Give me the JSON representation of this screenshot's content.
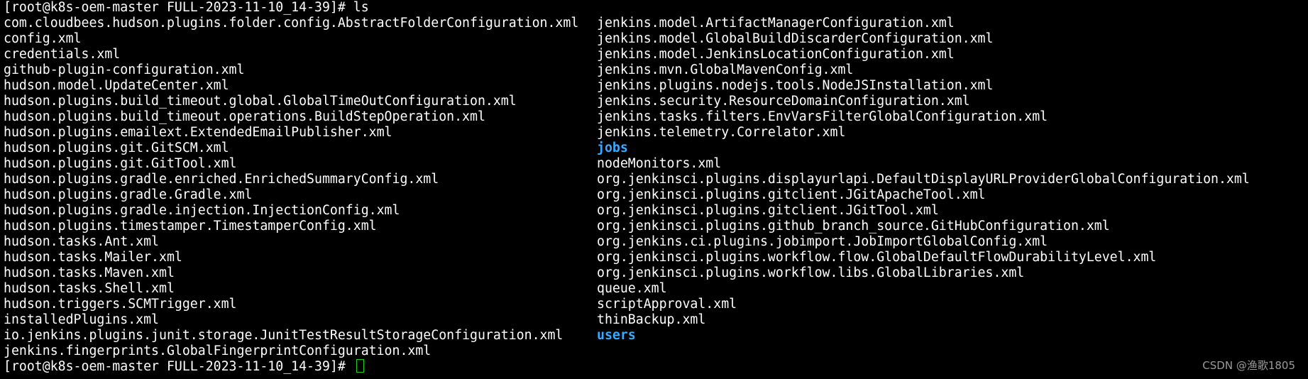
{
  "terminal": {
    "command_line": "[root@k8s-oem-master FULL-2023-11-10_14-39]# ls",
    "prompt": "[root@k8s-oem-master FULL-2023-11-10_14-39]# ",
    "colors": {
      "background": "#000000",
      "text": "#ffffff",
      "directory": "#3aa9ff",
      "cursor": "#19d219"
    },
    "left_column": [
      {
        "name": "com.cloudbees.hudson.plugins.folder.config.AbstractFolderConfiguration.xml",
        "type": "file"
      },
      {
        "name": "config.xml",
        "type": "file"
      },
      {
        "name": "credentials.xml",
        "type": "file"
      },
      {
        "name": "github-plugin-configuration.xml",
        "type": "file"
      },
      {
        "name": "hudson.model.UpdateCenter.xml",
        "type": "file"
      },
      {
        "name": "hudson.plugins.build_timeout.global.GlobalTimeOutConfiguration.xml",
        "type": "file"
      },
      {
        "name": "hudson.plugins.build_timeout.operations.BuildStepOperation.xml",
        "type": "file"
      },
      {
        "name": "hudson.plugins.emailext.ExtendedEmailPublisher.xml",
        "type": "file"
      },
      {
        "name": "hudson.plugins.git.GitSCM.xml",
        "type": "file"
      },
      {
        "name": "hudson.plugins.git.GitTool.xml",
        "type": "file"
      },
      {
        "name": "hudson.plugins.gradle.enriched.EnrichedSummaryConfig.xml",
        "type": "file"
      },
      {
        "name": "hudson.plugins.gradle.Gradle.xml",
        "type": "file"
      },
      {
        "name": "hudson.plugins.gradle.injection.InjectionConfig.xml",
        "type": "file"
      },
      {
        "name": "hudson.plugins.timestamper.TimestamperConfig.xml",
        "type": "file"
      },
      {
        "name": "hudson.tasks.Ant.xml",
        "type": "file"
      },
      {
        "name": "hudson.tasks.Mailer.xml",
        "type": "file"
      },
      {
        "name": "hudson.tasks.Maven.xml",
        "type": "file"
      },
      {
        "name": "hudson.tasks.Shell.xml",
        "type": "file"
      },
      {
        "name": "hudson.triggers.SCMTrigger.xml",
        "type": "file"
      },
      {
        "name": "installedPlugins.xml",
        "type": "file"
      },
      {
        "name": "io.jenkins.plugins.junit.storage.JunitTestResultStorageConfiguration.xml",
        "type": "file"
      },
      {
        "name": "jenkins.fingerprints.GlobalFingerprintConfiguration.xml",
        "type": "file"
      }
    ],
    "right_column": [
      {
        "name": "jenkins.model.ArtifactManagerConfiguration.xml",
        "type": "file"
      },
      {
        "name": "jenkins.model.GlobalBuildDiscarderConfiguration.xml",
        "type": "file"
      },
      {
        "name": "jenkins.model.JenkinsLocationConfiguration.xml",
        "type": "file"
      },
      {
        "name": "jenkins.mvn.GlobalMavenConfig.xml",
        "type": "file"
      },
      {
        "name": "jenkins.plugins.nodejs.tools.NodeJSInstallation.xml",
        "type": "file"
      },
      {
        "name": "jenkins.security.ResourceDomainConfiguration.xml",
        "type": "file"
      },
      {
        "name": "jenkins.tasks.filters.EnvVarsFilterGlobalConfiguration.xml",
        "type": "file"
      },
      {
        "name": "jenkins.telemetry.Correlator.xml",
        "type": "file"
      },
      {
        "name": "jobs",
        "type": "dir"
      },
      {
        "name": "nodeMonitors.xml",
        "type": "file"
      },
      {
        "name": "org.jenkinsci.plugins.displayurlapi.DefaultDisplayURLProviderGlobalConfiguration.xml",
        "type": "file"
      },
      {
        "name": "org.jenkinsci.plugins.gitclient.JGitApacheTool.xml",
        "type": "file"
      },
      {
        "name": "org.jenkinsci.plugins.gitclient.JGitTool.xml",
        "type": "file"
      },
      {
        "name": "org.jenkinsci.plugins.github_branch_source.GitHubConfiguration.xml",
        "type": "file"
      },
      {
        "name": "org.jenkins.ci.plugins.jobimport.JobImportGlobalConfig.xml",
        "type": "file"
      },
      {
        "name": "org.jenkinsci.plugins.workflow.flow.GlobalDefaultFlowDurabilityLevel.xml",
        "type": "file"
      },
      {
        "name": "org.jenkinsci.plugins.workflow.libs.GlobalLibraries.xml",
        "type": "file"
      },
      {
        "name": "queue.xml",
        "type": "file"
      },
      {
        "name": "scriptApproval.xml",
        "type": "file"
      },
      {
        "name": "thinBackup.xml",
        "type": "file"
      },
      {
        "name": "users",
        "type": "dir"
      }
    ]
  },
  "watermark": "CSDN @渔歌1805"
}
